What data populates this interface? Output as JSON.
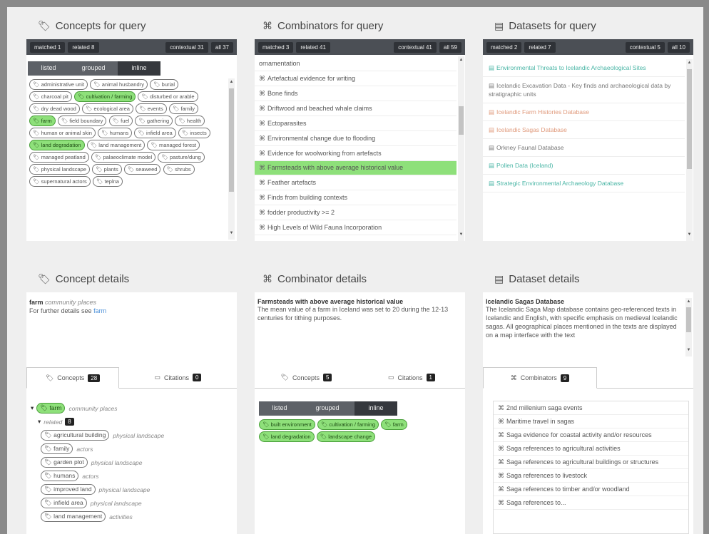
{
  "concepts_panel": {
    "title": "Concepts for query",
    "filters": [
      "matched 1",
      "related 8",
      "contextual 31",
      "all 37"
    ],
    "view_tabs": [
      "listed",
      "grouped",
      "inline"
    ],
    "tags": [
      {
        "label": "administrative unit",
        "hl": false
      },
      {
        "label": "animal husbandry",
        "hl": false
      },
      {
        "label": "burial",
        "hl": false
      },
      {
        "label": "charcoal pit",
        "hl": false
      },
      {
        "label": "cultivation / farming",
        "hl": true
      },
      {
        "label": "disturbed or arable",
        "hl": false
      },
      {
        "label": "dry dead wood",
        "hl": false
      },
      {
        "label": "ecological area",
        "hl": false
      },
      {
        "label": "events",
        "hl": false
      },
      {
        "label": "family",
        "hl": false
      },
      {
        "label": "farm",
        "hl": true
      },
      {
        "label": "field boundary",
        "hl": false
      },
      {
        "label": "fuel",
        "hl": false
      },
      {
        "label": "gathering",
        "hl": false
      },
      {
        "label": "health",
        "hl": false
      },
      {
        "label": "human or animal skin",
        "hl": false
      },
      {
        "label": "humans",
        "hl": false
      },
      {
        "label": "infield area",
        "hl": false
      },
      {
        "label": "insects",
        "hl": false
      },
      {
        "label": "land degradation",
        "hl": true
      },
      {
        "label": "land management",
        "hl": false
      },
      {
        "label": "managed forest",
        "hl": false
      },
      {
        "label": "managed peatland",
        "hl": false
      },
      {
        "label": "palaeoclimate model",
        "hl": false
      },
      {
        "label": "pasture/dung",
        "hl": false
      },
      {
        "label": "physical landscape",
        "hl": false
      },
      {
        "label": "plants",
        "hl": false
      },
      {
        "label": "seaweed",
        "hl": false
      },
      {
        "label": "shrubs",
        "hl": false
      },
      {
        "label": "supernatural actors",
        "hl": false
      },
      {
        "label": "teplna",
        "hl": false
      }
    ]
  },
  "combinators_panel": {
    "title": "Combinators for query",
    "filters": [
      "matched 3",
      "related 41",
      "contextual 41",
      "all 59"
    ],
    "items": [
      {
        "label": "ornamentation",
        "sel": false,
        "icon": false
      },
      {
        "label": "Artefactual evidence for writing",
        "sel": false,
        "icon": true
      },
      {
        "label": "Bone finds",
        "sel": false,
        "icon": true
      },
      {
        "label": "Driftwood and beached whale claims",
        "sel": false,
        "icon": true
      },
      {
        "label": "Ectoparasites",
        "sel": false,
        "icon": true
      },
      {
        "label": "Environmental change due to flooding",
        "sel": false,
        "icon": true
      },
      {
        "label": "Evidence for woolworking from artefacts",
        "sel": false,
        "icon": true
      },
      {
        "label": "Farmsteads with above average historical value",
        "sel": true,
        "icon": true
      },
      {
        "label": "Feather artefacts",
        "sel": false,
        "icon": true
      },
      {
        "label": "Finds from building contexts",
        "sel": false,
        "icon": true
      },
      {
        "label": "fodder productivity >= 2",
        "sel": false,
        "icon": true
      },
      {
        "label": "High Levels of Wild Fauna Incorporation",
        "sel": false,
        "icon": true
      }
    ]
  },
  "datasets_panel": {
    "title": "Datasets for query",
    "filters": [
      "matched 2",
      "related 7",
      "contextual 5",
      "all 10"
    ],
    "items": [
      {
        "label": "Environmental Threats to Icelandic Archaeological Sites",
        "color": "teal"
      },
      {
        "label": "Icelandic Excavation Data - Key finds and archaeological data by stratigraphic units",
        "color": "gray"
      },
      {
        "label": "Icelandic Farm Histories Database",
        "color": "orange"
      },
      {
        "label": "Icelandic Sagas Database",
        "color": "orange"
      },
      {
        "label": "Orkney Faunal Database",
        "color": "gray"
      },
      {
        "label": "Pollen Data (Iceland)",
        "color": "teal"
      },
      {
        "label": "Strategic Environmental Archaeology Database",
        "color": "teal"
      }
    ]
  },
  "concept_details": {
    "title": "Concept details",
    "name": "farm",
    "category": "community places",
    "further_prefix": "For further details see",
    "further_link": "farm",
    "tab_concepts": "Concepts",
    "tab_concepts_count": "28",
    "tab_citations": "Citations",
    "tab_citations_count": "0",
    "tree_root": {
      "label": "farm",
      "cat": "community places"
    },
    "tree_group": {
      "label": "related",
      "count": "8"
    },
    "tree_items": [
      {
        "label": "agricultural building",
        "cat": "physical landscape"
      },
      {
        "label": "family",
        "cat": "actors"
      },
      {
        "label": "garden plot",
        "cat": "physical landscape"
      },
      {
        "label": "humans",
        "cat": "actors"
      },
      {
        "label": "improved land",
        "cat": "physical landscape"
      },
      {
        "label": "infield area",
        "cat": "physical landscape"
      },
      {
        "label": "land management",
        "cat": "activities"
      }
    ]
  },
  "combinator_details": {
    "title": "Combinator details",
    "name": "Farmsteads with above average historical value",
    "description": "The mean value of a farm in Iceland was set to 20 during the 12-13 centuries for tithing purposes.",
    "tab_concepts": "Concepts",
    "tab_concepts_count": "5",
    "tab_citations": "Citations",
    "tab_citations_count": "1",
    "view_tabs": [
      "listed",
      "grouped",
      "inline"
    ],
    "tags": [
      "built environment",
      "cultivation / farming",
      "farm",
      "land degradation",
      "landscape change"
    ]
  },
  "dataset_details": {
    "title": "Dataset details",
    "name": "Icelandic Sagas Database",
    "description": "The Icelandic Saga Map database contains geo-referenced texts in Icelandic and English, with specific emphasis on medieval Icelandic sagas. All geographical places mentioned in the texts are displayed on a map interface with the text",
    "tab_combinators": "Combinators",
    "tab_combinators_count": "9",
    "items": [
      "2nd millenium saga events",
      "Maritime travel in sagas",
      "Saga evidence for coastal activity and/or resources",
      "Saga references to agricultural activities",
      "Saga references to agricultural buildings or structures",
      "Saga references to livestock",
      "Saga references to timber and/or woodland",
      "Saga references to..."
    ]
  }
}
